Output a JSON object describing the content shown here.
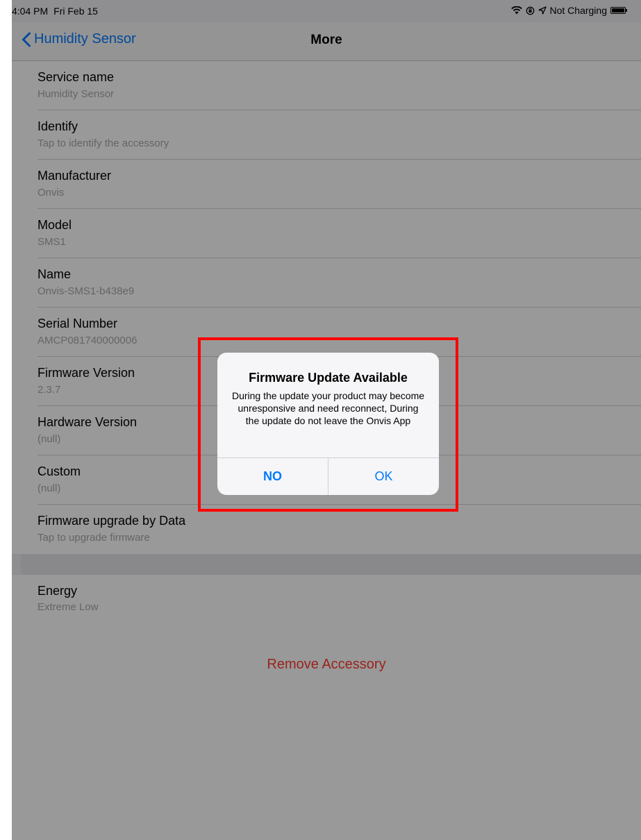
{
  "status_bar": {
    "time": "4:04 PM",
    "date": "Fri Feb 15",
    "battery_text": "Not Charging",
    "icons": [
      "wifi-icon",
      "orientation-lock-icon",
      "location-icon",
      "battery-icon"
    ]
  },
  "nav": {
    "back_label": "Humidity Sensor",
    "title": "More"
  },
  "list": {
    "items": [
      {
        "title": "Service name",
        "subtitle": "Humidity Sensor"
      },
      {
        "title": "Identify",
        "subtitle": "Tap to identify the accessory"
      },
      {
        "title": "Manufacturer",
        "subtitle": "Onvis"
      },
      {
        "title": "Model",
        "subtitle": "SMS1"
      },
      {
        "title": "Name",
        "subtitle": "Onvis-SMS1-b438e9"
      },
      {
        "title": "Serial Number",
        "subtitle": "AMCP081740000006"
      },
      {
        "title": "Firmware Version",
        "subtitle": "2.3.7"
      },
      {
        "title": "Hardware Version",
        "subtitle": "(null)"
      },
      {
        "title": "Custom",
        "subtitle": "(null)"
      },
      {
        "title": "Firmware upgrade by Data",
        "subtitle": "Tap to upgrade firmware"
      }
    ],
    "energy": {
      "title": "Energy",
      "subtitle": "Extreme Low"
    }
  },
  "remove_accessory_label": "Remove Accessory",
  "alert": {
    "title": "Firmware Update Available",
    "message": "During the update your product may become unresponsive and need reconnect, During the update do not leave the Onvis App",
    "no_label": "NO",
    "ok_label": "OK"
  },
  "colors": {
    "accent": "#007aff",
    "destructive": "#ff3b30",
    "highlight": "#ff0000"
  }
}
